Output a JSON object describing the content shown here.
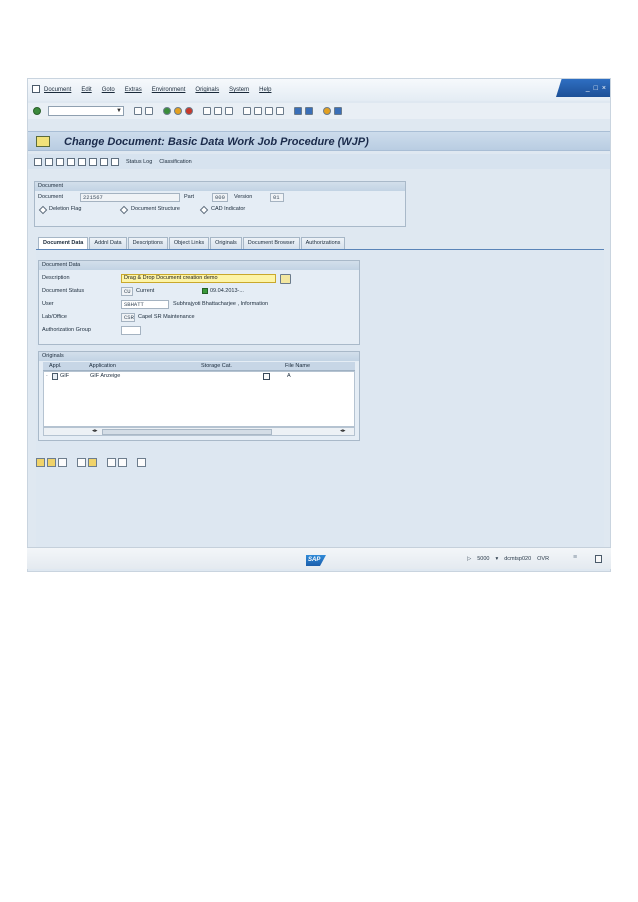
{
  "menubar": {
    "items": [
      "Document",
      "Edit",
      "Goto",
      "Extras",
      "Environment",
      "Originals",
      "System",
      "Help"
    ],
    "window_controls": [
      "_",
      "□",
      "×"
    ]
  },
  "toolbar": {
    "command_field_value": ""
  },
  "title": {
    "text": "Change Document: Basic Data Work Job Procedure (WJP)"
  },
  "app_toolbar": {
    "status_log_label": "Status Log",
    "classification_label": "Classification"
  },
  "document_group": {
    "header": "Document",
    "document_label": "Document",
    "document_value": "221567",
    "part_label": "Part",
    "part_value": "000",
    "version_label": "Version",
    "version_value": "01",
    "deletion_flag_label": "Deletion Flag",
    "document_structure_label": "Document Structure",
    "cad_indicator_label": "CAD Indicator"
  },
  "tabs": [
    "Document Data",
    "Addnl Data",
    "Descriptions",
    "Object Links",
    "Originals",
    "Document Browser",
    "Authorizations"
  ],
  "document_data": {
    "header": "Document Data",
    "description_label": "Description",
    "description_value": "Drag & Drop Document creation demo",
    "status_label": "Document Status",
    "status_code": "CU",
    "status_text": "Current",
    "status_date": "09.04.2013-...",
    "user_label": "User",
    "user_value": "SBHATT",
    "user_name": "Subhrajyoti Bhattacharjee , Information",
    "lab_label": "Lab/Office",
    "lab_code": "CSR",
    "lab_text": "Capel SR Maintenance",
    "auth_group_label": "Authorization Group",
    "auth_group_value": ""
  },
  "originals": {
    "header": "Originals",
    "columns": [
      "Appl.",
      "Application",
      "Storage Cat.",
      "File Name"
    ],
    "rows": [
      {
        "appl": "GIF",
        "application": "GIF Anzeige",
        "storage": "",
        "file_name": "A"
      }
    ]
  },
  "statusbar": {
    "logo": "SAP",
    "system": "5000",
    "server": "dcmtsp020",
    "mode": "OVR"
  }
}
